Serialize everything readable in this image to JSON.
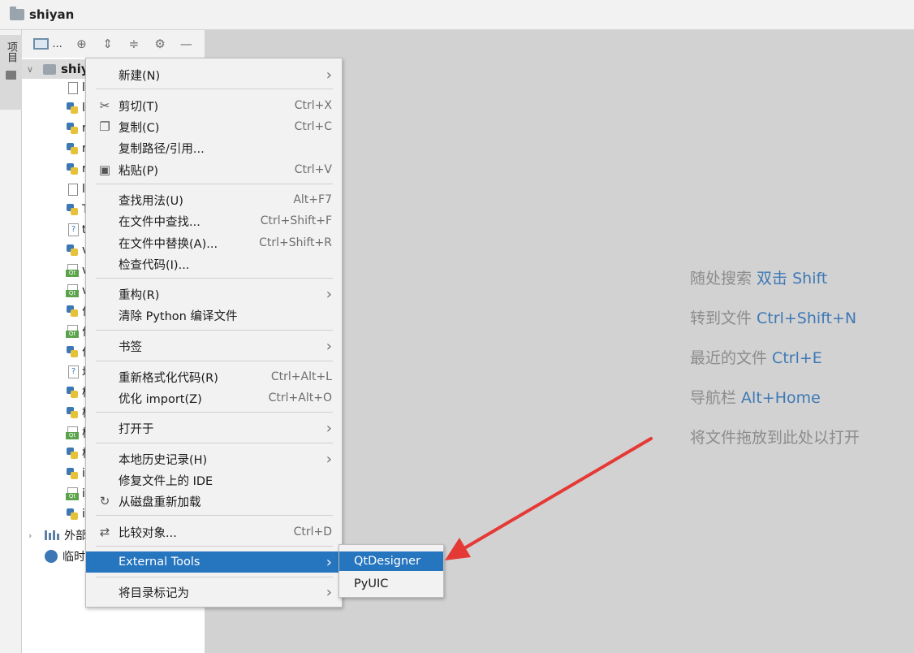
{
  "window": {
    "title": "shiyan"
  },
  "tool_strip": {
    "project_tab_label": "项目"
  },
  "project_panel": {
    "toolbar": {
      "view_dots": "...",
      "icons": [
        "locate-icon",
        "expand-all-icon",
        "collapse-all-icon",
        "gear-icon",
        "minimize-icon"
      ]
    },
    "root_label": "shiy",
    "items": [
      {
        "icon": "list-file-icon",
        "label": "l"
      },
      {
        "icon": "python-file-icon",
        "label": "l"
      },
      {
        "icon": "python-file-icon",
        "label": "r"
      },
      {
        "icon": "python-file-icon",
        "label": "r"
      },
      {
        "icon": "python-file-icon",
        "label": "r"
      },
      {
        "icon": "text-file-icon",
        "label": "l"
      },
      {
        "icon": "python-file-icon",
        "label": "T"
      },
      {
        "icon": "unknown-file-icon",
        "label": "t"
      },
      {
        "icon": "python-file-icon",
        "label": "v"
      },
      {
        "icon": "qt-ui-file-icon",
        "label": "v"
      },
      {
        "icon": "qt-ui-file-icon",
        "label": "v"
      },
      {
        "icon": "python-file-icon",
        "label": "作"
      },
      {
        "icon": "qt-ui-file-icon",
        "label": "作"
      },
      {
        "icon": "python-file-icon",
        "label": "作"
      },
      {
        "icon": "unknown-file-icon",
        "label": "均"
      },
      {
        "icon": "python-file-icon",
        "label": "杨"
      },
      {
        "icon": "python-file-icon",
        "label": "杨"
      },
      {
        "icon": "qt-ui-file-icon",
        "label": "杨"
      },
      {
        "icon": "python-file-icon",
        "label": "杨"
      },
      {
        "icon": "python-file-icon",
        "label": "i"
      },
      {
        "icon": "qt-ui-file-icon",
        "label": "i"
      },
      {
        "icon": "python-file-icon",
        "label": "i"
      }
    ],
    "external_libraries_label": "外部",
    "scratches_label": "临时"
  },
  "context_menu": {
    "items": [
      {
        "label": "新建(N)",
        "submenu": true
      },
      {
        "label": "剪切(T)",
        "shortcut": "Ctrl+X",
        "icon": "scissors-icon"
      },
      {
        "label": "复制(C)",
        "shortcut": "Ctrl+C",
        "icon": "copy-icon"
      },
      {
        "label": "复制路径/引用..."
      },
      {
        "label": "粘贴(P)",
        "shortcut": "Ctrl+V",
        "icon": "paste-icon"
      },
      {
        "label": "查找用法(U)",
        "shortcut": "Alt+F7"
      },
      {
        "label": "在文件中查找...",
        "shortcut": "Ctrl+Shift+F"
      },
      {
        "label": "在文件中替换(A)...",
        "shortcut": "Ctrl+Shift+R"
      },
      {
        "label": "检查代码(I)..."
      },
      {
        "label": "重构(R)",
        "submenu": true
      },
      {
        "label": "清除 Python 编译文件"
      },
      {
        "label": "书签",
        "submenu": true
      },
      {
        "label": "重新格式化代码(R)",
        "shortcut": "Ctrl+Alt+L"
      },
      {
        "label": "优化 import(Z)",
        "shortcut": "Ctrl+Alt+O"
      },
      {
        "label": "打开于",
        "submenu": true
      },
      {
        "label": "本地历史记录(H)",
        "submenu": true
      },
      {
        "label": "修复文件上的 IDE"
      },
      {
        "label": "从磁盘重新加载",
        "icon": "reload-icon"
      },
      {
        "label": "比较对象...",
        "shortcut": "Ctrl+D",
        "icon": "compare-icon"
      },
      {
        "label": "External Tools",
        "submenu": true,
        "highlighted": true
      },
      {
        "label": "将目录标记为",
        "submenu": true
      }
    ],
    "submenu_external_tools": [
      {
        "label": "QtDesigner",
        "highlighted": true
      },
      {
        "label": "PyUIC"
      }
    ]
  },
  "editor_hints": [
    {
      "text": "随处搜索 ",
      "key": "双击 Shift"
    },
    {
      "text": "转到文件 ",
      "key": "Ctrl+Shift+N"
    },
    {
      "text": "最近的文件 ",
      "key": "Ctrl+E"
    },
    {
      "text": "导航栏 ",
      "key": "Alt+Home"
    },
    {
      "text": "将文件拖放到此处以打开",
      "key": ""
    }
  ],
  "colors": {
    "accent": "#2675bf",
    "hint_key": "#3f79b6",
    "annotation_arrow": "#e53935"
  }
}
